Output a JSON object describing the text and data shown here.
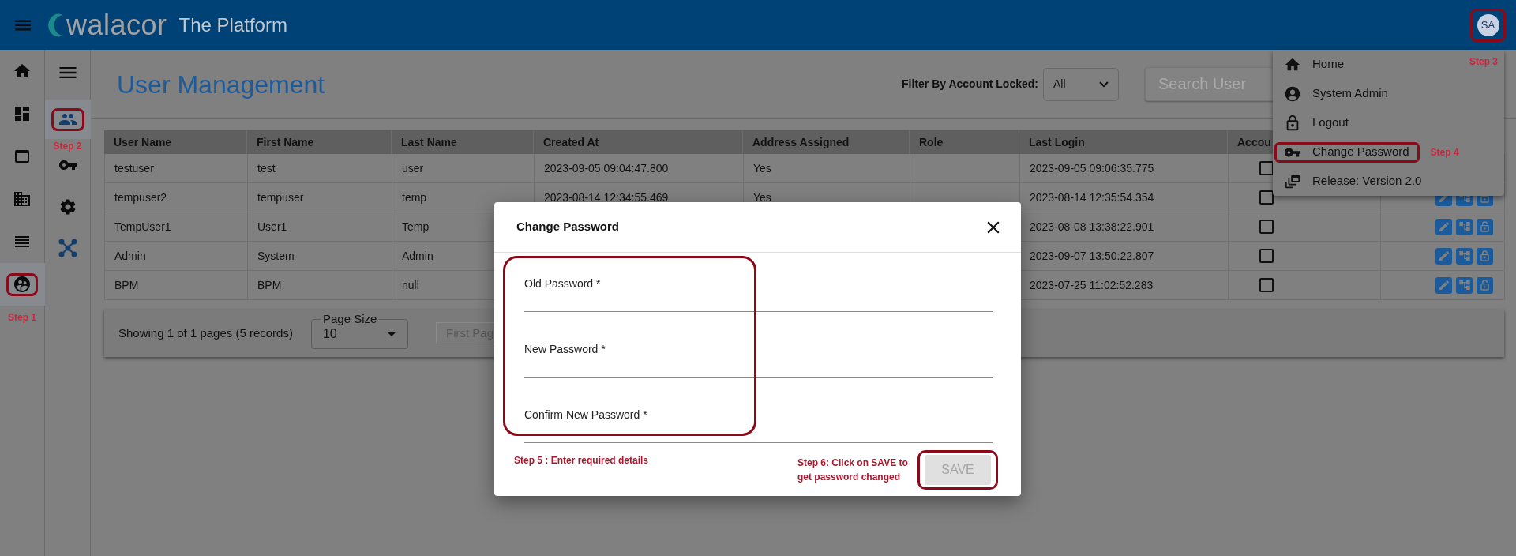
{
  "header": {
    "logo_text": "walacor",
    "title": "The Platform",
    "avatar": {
      "initials": "SA",
      "highlighted": true
    }
  },
  "nav_rail": [
    {
      "kind": "home",
      "selected": false
    },
    {
      "kind": "dashboard",
      "selected": false
    },
    {
      "kind": "web",
      "selected": false
    },
    {
      "kind": "business",
      "selected": false
    },
    {
      "kind": "list",
      "selected": false
    },
    {
      "kind": "users-circle",
      "selected": true,
      "highlighted": true,
      "annotation": "Step 1"
    }
  ],
  "sub_rail": [
    {
      "kind": "menu",
      "selected": false
    },
    {
      "kind": "people",
      "selected": true,
      "highlighted": true,
      "annotation": "Step 2"
    },
    {
      "kind": "key",
      "selected": false
    },
    {
      "kind": "gear",
      "selected": false
    },
    {
      "kind": "network",
      "selected": false
    }
  ],
  "page": {
    "title": "User Management",
    "filter": {
      "label": "Filter By Account Locked:",
      "value": "All"
    },
    "search": {
      "placeholder": "Search User"
    }
  },
  "table": {
    "columns": [
      "User Name",
      "First Name",
      "Last Name",
      "Created At",
      "Address Assigned",
      "Role",
      "Last Login",
      "Accou"
    ],
    "rows": [
      {
        "user_name": "testuser",
        "first_name": "test",
        "last_name": "user",
        "created_at": "2023-09-05 09:04:47.800",
        "address_assigned": "Yes",
        "last_login": "2023-09-05 09:06:35.775",
        "locked": false
      },
      {
        "user_name": "tempuser2",
        "first_name": "tempuser",
        "last_name": "temp",
        "created_at": "2023-08-14 12:34:55.469",
        "address_assigned": "Yes",
        "last_login": "2023-08-14 12:35:54.354",
        "locked": false,
        "actions": [
          {
            "kind": "edit"
          },
          {
            "kind": "tree"
          },
          {
            "kind": "lock"
          }
        ]
      },
      {
        "user_name": "TempUser1",
        "first_name": "User1",
        "last_name": "Temp",
        "last_login": "2023-08-08 13:38:22.901",
        "locked": false,
        "actions": [
          {
            "kind": "edit"
          },
          {
            "kind": "tree"
          },
          {
            "kind": "lock"
          }
        ]
      },
      {
        "user_name": "Admin",
        "first_name": "System",
        "last_name": "Admin",
        "last_login": "2023-09-07 13:50:22.807",
        "locked": false,
        "actions": [
          {
            "kind": "edit"
          },
          {
            "kind": "tree"
          },
          {
            "kind": "lock"
          }
        ]
      },
      {
        "user_name": "BPM",
        "first_name": "BPM",
        "last_name": "null",
        "last_login": "2023-07-25 11:02:52.283",
        "locked": false,
        "actions": [
          {
            "kind": "edit"
          },
          {
            "kind": "tree"
          },
          {
            "kind": "lock"
          }
        ]
      }
    ]
  },
  "pagination": {
    "summary": "Showing 1 of 1 pages (5 records)",
    "page_size": {
      "label": "Page Size",
      "value": "10"
    },
    "first_button": "First Pag"
  },
  "user_menu": {
    "annotation": "Step 3",
    "items": [
      {
        "kind": "home",
        "label": "Home",
        "highlighted": false
      },
      {
        "kind": "account",
        "label": "System Admin",
        "highlighted": false
      },
      {
        "kind": "lock",
        "label": "Logout",
        "highlighted": false
      },
      {
        "kind": "key",
        "label": "Change Password",
        "highlighted": true,
        "annotation": "Step 4"
      },
      {
        "kind": "release",
        "label": "Release: Version 2.0",
        "highlighted": false
      }
    ]
  },
  "dialog": {
    "title": "Change Password",
    "fields": [
      {
        "label": "Old Password *"
      },
      {
        "label": "New Password *"
      },
      {
        "label": "Confirm New Password *"
      }
    ],
    "fields_highlighted": true,
    "fields_annotation": "Step 5 : Enter required details",
    "save": {
      "label": "SAVE",
      "disabled": true,
      "highlighted": true,
      "annotation": "Step 6: Click on SAVE to get password changed"
    }
  }
}
